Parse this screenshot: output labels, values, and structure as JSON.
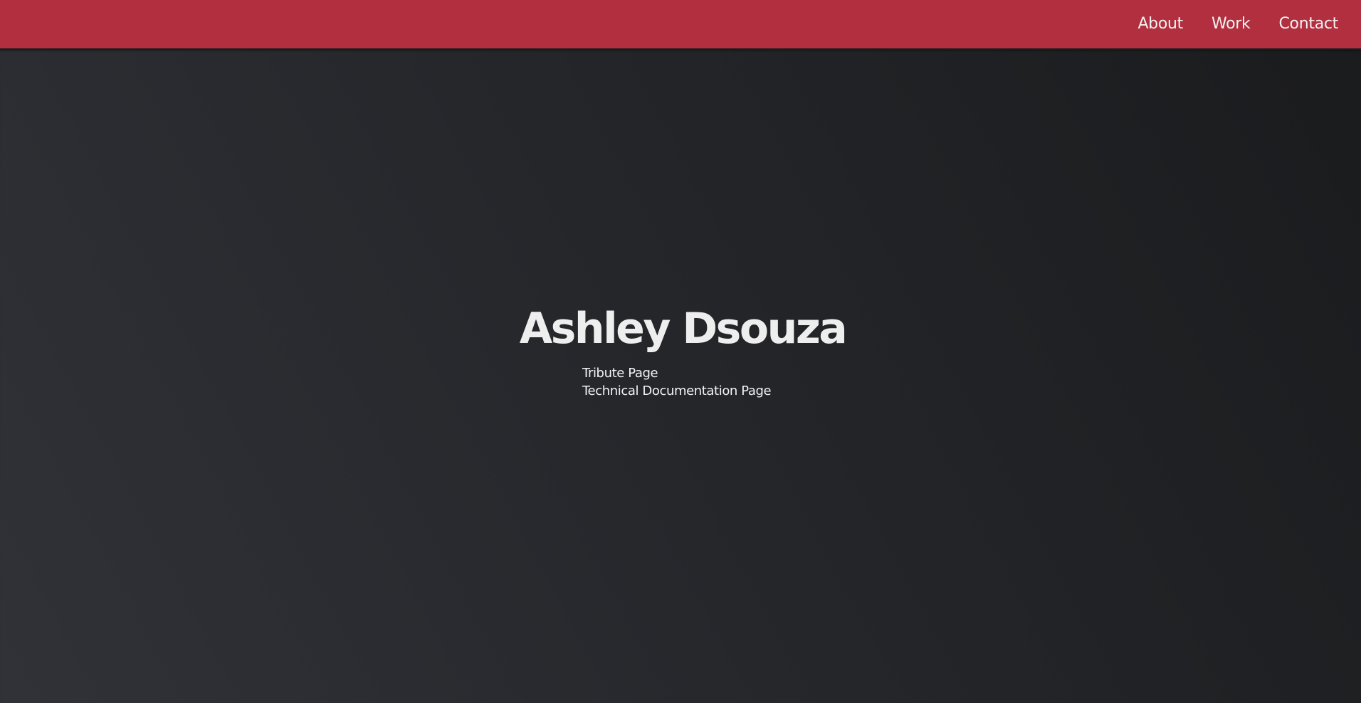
{
  "nav": {
    "items": [
      {
        "label": "About"
      },
      {
        "label": "Work"
      },
      {
        "label": "Contact"
      }
    ]
  },
  "hero": {
    "name": "Ashley Dsouza",
    "projects": [
      {
        "label": "Tribute Page"
      },
      {
        "label": "Technical Documentation Page"
      }
    ]
  },
  "colors": {
    "navbar": "#b22f3f",
    "background_start": "#303238",
    "background_end": "#1a1b1d",
    "text": "#eeeeee"
  }
}
